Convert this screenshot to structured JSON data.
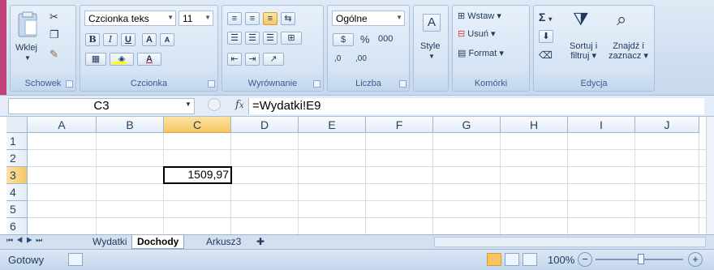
{
  "ribbon": {
    "clipboard": {
      "paste_label": "Wklej",
      "group_label": "Schowek"
    },
    "font": {
      "font_name": "Czcionka teks",
      "font_size": "11",
      "bold": "B",
      "italic": "I",
      "underline": "U",
      "grow": "A",
      "shrink": "A",
      "font_color_letter": "A",
      "group_label": "Czcionka"
    },
    "alignment": {
      "group_label": "Wyrównanie"
    },
    "number": {
      "format": "Ogólne",
      "percent": "%",
      "thousands": "000",
      "inc_dec": ",0",
      "dec_dec": ",00",
      "group_label": "Liczba"
    },
    "styles": {
      "label": "Style"
    },
    "cells": {
      "insert": "Wstaw",
      "delete": "Usuń",
      "format": "Format",
      "group_label": "Komórki"
    },
    "editing": {
      "sum": "Σ",
      "sort_line1": "Sortuj i",
      "sort_line2": "filtruj",
      "find_line1": "Znajdź i",
      "find_line2": "zaznacz",
      "group_label": "Edycja"
    },
    "colors": {
      "font_color": "#e0001b",
      "highlight": "#ffff00",
      "accent": "#c0427a"
    }
  },
  "formula_bar": {
    "name_box": "C3",
    "fx": "fx",
    "formula": "=Wydatki!E9"
  },
  "grid": {
    "columns": [
      "A",
      "B",
      "C",
      "D",
      "E",
      "F",
      "G",
      "H",
      "I",
      "J"
    ],
    "rows": [
      "1",
      "2",
      "3",
      "4",
      "5",
      "6"
    ],
    "active_cell": {
      "ref": "C3",
      "value": "1509,97"
    }
  },
  "sheets": [
    "Wydatki",
    "Dochody",
    "Arkusz3"
  ],
  "active_sheet": "Dochody",
  "status": {
    "mode": "Gotowy",
    "zoom": "100%",
    "minus": "−",
    "plus": "+"
  }
}
